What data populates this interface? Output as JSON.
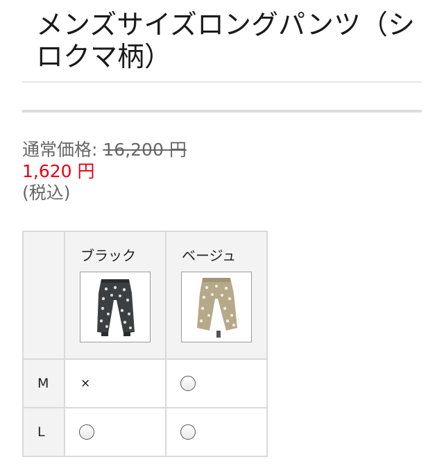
{
  "product": {
    "title": "メンズサイズロングパンツ（シロクマ柄）"
  },
  "price": {
    "regular_label": "通常価格:",
    "regular_price": "16,200 円",
    "sale_price": "1,620 円",
    "tax_note": "(税込)"
  },
  "variants": {
    "colors": [
      {
        "name": "ブラック",
        "image": "pants-black-polar-bear-thumbnail"
      },
      {
        "name": "ベージュ",
        "image": "pants-beige-polar-bear-thumbnail"
      }
    ],
    "sizes": [
      {
        "label": "M",
        "availability": [
          "×",
          "radio"
        ]
      },
      {
        "label": "L",
        "availability": [
          "radio",
          "radio"
        ]
      }
    ],
    "soldout_mark": "×"
  },
  "colors": {
    "sale_price": "#e60012",
    "border": "#d9d9d9",
    "header_bg": "#f3f3f3"
  }
}
